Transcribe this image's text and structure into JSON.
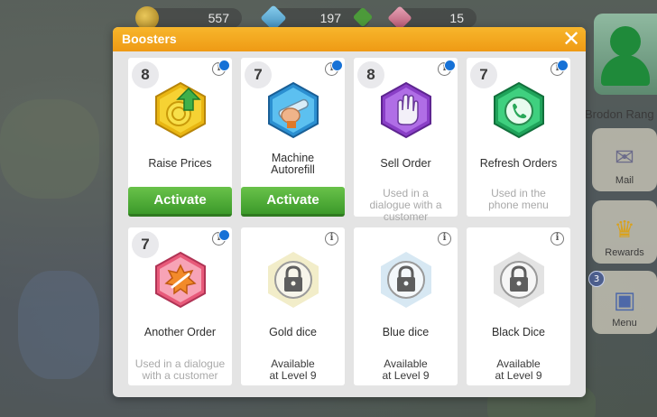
{
  "hud": {
    "coins": "557",
    "gems": "197",
    "tickets": "15"
  },
  "player": {
    "name": "Brodon Rang"
  },
  "side_menu": {
    "mail": "Mail",
    "rewards": "Rewards",
    "menu": "Menu",
    "menu_badge": "3"
  },
  "modal": {
    "title": "Boosters",
    "close": "✕"
  },
  "boosters": [
    {
      "name": "Raise Prices",
      "count": "8",
      "action": "Activate",
      "is_new": true,
      "icon": "raise-prices-icon",
      "color": "#f2c61a"
    },
    {
      "name": "Machine\nAutorefill",
      "count": "7",
      "action": "Activate",
      "is_new": true,
      "icon": "machine-autorefill-icon",
      "color": "#3aa3e3"
    },
    {
      "name": "Sell Order",
      "count": "8",
      "note": "Used in a dialogue with a customer",
      "is_new": true,
      "icon": "sell-order-icon",
      "color": "#a25bd8"
    },
    {
      "name": "Refresh Orders",
      "count": "7",
      "note": "Used in the phone menu",
      "is_new": true,
      "icon": "refresh-orders-icon",
      "color": "#2ebc6a"
    },
    {
      "name": "Another Order",
      "count": "7",
      "note": "Used in a dialogue with a customer",
      "is_new": true,
      "icon": "another-order-icon",
      "color": "#f2708a"
    },
    {
      "name": "Gold dice",
      "status_line1": "Available",
      "status_line2": "at Level 9",
      "icon": "gold-dice-lock-icon",
      "color": "#f1ecc8"
    },
    {
      "name": "Blue dice",
      "status_line1": "Available",
      "status_line2": "at Level 9",
      "icon": "blue-dice-lock-icon",
      "color": "#d6e7f2"
    },
    {
      "name": "Black Dice",
      "status_line1": "Available",
      "status_line2": "at Level 9",
      "icon": "black-dice-lock-icon",
      "color": "#e2e2e2"
    }
  ]
}
